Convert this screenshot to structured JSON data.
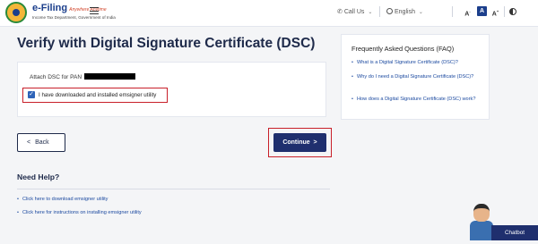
{
  "header": {
    "brand_title": "e-Filing",
    "brand_tagline": "Anywhere Anytime",
    "brand_subtitle": "Income Tax Department, Government of India",
    "call_us": "Call Us",
    "language": "English",
    "font_small": "A",
    "font_normal": "A",
    "font_large": "A",
    "font_small_sup": "-",
    "font_large_sup": "+"
  },
  "page": {
    "title": "Verify with Digital Signature Certificate (DSC)"
  },
  "dsc_card": {
    "pan_label": "Attach DSC for PAN",
    "checkbox_label": "I have downloaded and installed emsigner utility",
    "checkbox_checked": true
  },
  "faq": {
    "title": "Frequently Asked Questions (FAQ)",
    "items": [
      "What is a Digital Signature Certificate (DSC)?",
      "Why do I need a Digital Signature Certificate (DSC)?",
      "How does a Digital Signature Certificate (DSC) work?"
    ]
  },
  "actions": {
    "back_label": "Back",
    "continue_label": "Continue"
  },
  "help": {
    "title": "Need Help?",
    "links": [
      "Click here to download emsigner utility",
      "Click here for instructions on installing emsigner utility"
    ]
  },
  "chatbot": {
    "label": "Chatbot"
  },
  "colors": {
    "primary": "#1f2f6e",
    "link": "#1c4aa0",
    "highlight_outline": "#c8202a",
    "checkbox": "#2e63b8",
    "page_bg": "#f4f5f7"
  }
}
